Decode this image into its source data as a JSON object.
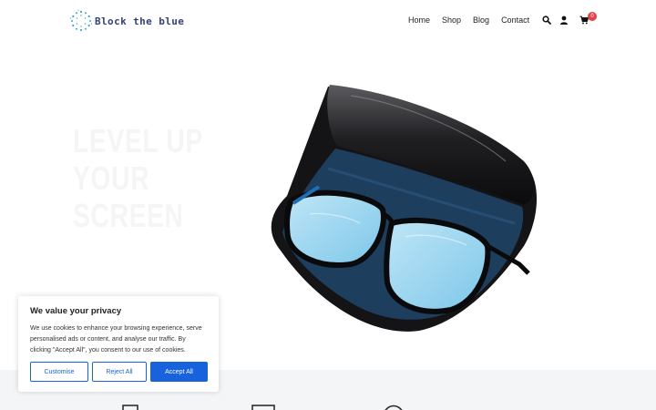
{
  "brand": {
    "name": "Block the blue"
  },
  "nav": {
    "items": [
      "Home",
      "Shop",
      "Blog",
      "Contact"
    ]
  },
  "header_icons": {
    "search": "search-icon",
    "account": "user-icon",
    "cart": "cart-icon"
  },
  "cart": {
    "count": "0",
    "badge_color": "#e0434b"
  },
  "hero": {
    "title_line1": "LEVEL UP YOUR",
    "title_line2": "SCREEN",
    "image": "blue-light-glasses-in-case"
  },
  "cookie": {
    "title": "We value your privacy",
    "text": "We use cookies to enhance your browsing experience, serve personalised ads or content, and analyse our traffic. By clicking \"Accept All\", you consent to our use of cookies.",
    "buttons": {
      "customise": "Customise",
      "reject": "Reject All",
      "accept": "Accept All"
    },
    "accent_color": "#1863dc"
  },
  "colors": {
    "brand_text": "#35407a",
    "features_bg": "#f4f5f7"
  }
}
